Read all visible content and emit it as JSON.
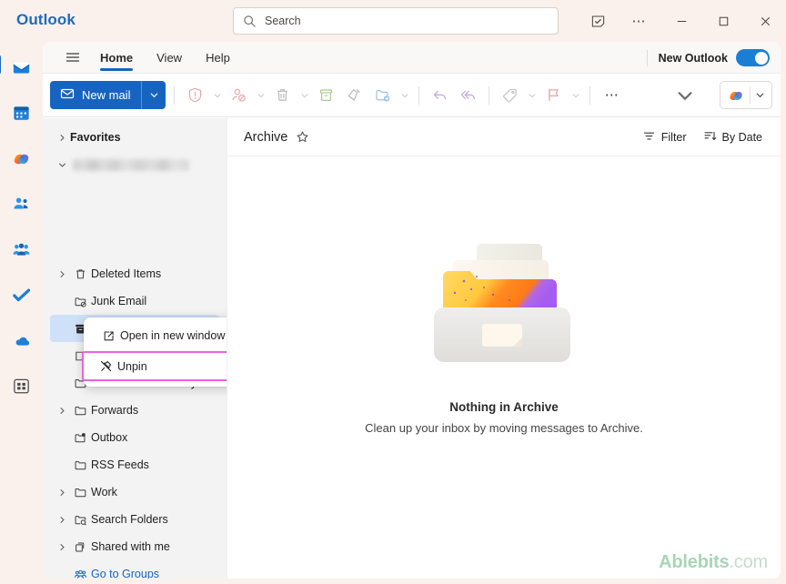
{
  "titlebar": {
    "brand": "Outlook",
    "search_placeholder": "Search",
    "buttons": [
      {
        "name": "notes-icon",
        "label": "Notes"
      },
      {
        "name": "more-options-icon",
        "label": "…"
      },
      {
        "name": "minimize-icon",
        "label": "Minimize"
      },
      {
        "name": "maximize-icon",
        "label": "Maximize"
      },
      {
        "name": "close-icon",
        "label": "Close"
      }
    ]
  },
  "rail": {
    "items": [
      {
        "icon": "mail-icon",
        "label": "Mail",
        "active": true
      },
      {
        "icon": "calendar-icon",
        "label": "Calendar",
        "active": false
      },
      {
        "icon": "copilot-icon",
        "label": "Copilot",
        "active": false
      },
      {
        "icon": "people-icon",
        "label": "People",
        "active": false
      },
      {
        "icon": "groups-icon",
        "label": "Groups",
        "active": false
      },
      {
        "icon": "todo-icon",
        "label": "To Do",
        "active": false
      },
      {
        "icon": "onedrive-icon",
        "label": "OneDrive",
        "active": false
      },
      {
        "icon": "apps-icon",
        "label": "More apps",
        "active": false
      }
    ]
  },
  "ribbon": {
    "tabs": [
      {
        "label": "Home",
        "active": true
      },
      {
        "label": "View",
        "active": false
      },
      {
        "label": "Help",
        "active": false
      }
    ],
    "new_outlook_label": "New Outlook",
    "new_outlook_on": true
  },
  "commandbar": {
    "new_mail_label": "New mail",
    "icons": [
      {
        "name": "report-icon",
        "caret": true
      },
      {
        "name": "block-sender-icon",
        "caret": true
      },
      {
        "name": "delete-icon",
        "caret": true
      },
      {
        "name": "archive-icon",
        "caret": false
      },
      {
        "name": "sweep-icon",
        "caret": false
      },
      {
        "name": "move-to-icon",
        "caret": true
      },
      {
        "name": "reply-icon",
        "caret": false
      },
      {
        "name": "reply-all-icon",
        "caret": false
      },
      {
        "name": "categorize-icon",
        "caret": true
      },
      {
        "name": "flag-icon",
        "caret": true
      }
    ],
    "more_commands_label": "…",
    "copilot_label": "Copilot"
  },
  "folders": {
    "items": [
      {
        "label": "Favorites",
        "chevron": "right",
        "icon": "",
        "bold": true,
        "selected": false,
        "blurred": false,
        "link": false
      },
      {
        "label": "",
        "chevron": "down",
        "icon": "",
        "bold": false,
        "selected": false,
        "blurred": true,
        "link": false
      },
      {
        "label": "Deleted Items",
        "chevron": "right",
        "icon": "trash-icon",
        "bold": false,
        "selected": false,
        "blurred": false,
        "link": false
      },
      {
        "label": "Junk Email",
        "chevron": "",
        "icon": "junk-icon",
        "bold": false,
        "selected": false,
        "blurred": false,
        "link": false
      },
      {
        "label": "Archive",
        "chevron": "",
        "icon": "archive-box-icon",
        "bold": false,
        "selected": true,
        "blurred": false,
        "link": false
      },
      {
        "label": "Notes",
        "chevron": "",
        "icon": "note-icon",
        "bold": false,
        "selected": false,
        "blurred": false,
        "link": false
      },
      {
        "label": "Conversation History",
        "chevron": "",
        "icon": "folder-icon",
        "bold": false,
        "selected": false,
        "blurred": false,
        "link": false
      },
      {
        "label": "Forwards",
        "chevron": "right",
        "icon": "folder-icon",
        "bold": false,
        "selected": false,
        "blurred": false,
        "link": false
      },
      {
        "label": "Outbox",
        "chevron": "",
        "icon": "outbox-icon",
        "bold": false,
        "selected": false,
        "blurred": false,
        "link": false
      },
      {
        "label": "RSS Feeds",
        "chevron": "",
        "icon": "folder-icon",
        "bold": false,
        "selected": false,
        "blurred": false,
        "link": false
      },
      {
        "label": "Work",
        "chevron": "right",
        "icon": "folder-icon",
        "bold": false,
        "selected": false,
        "blurred": false,
        "link": false
      },
      {
        "label": "Search Folders",
        "chevron": "right",
        "icon": "search-folder-icon",
        "bold": false,
        "selected": false,
        "blurred": false,
        "link": false
      },
      {
        "label": "Shared with me",
        "chevron": "right",
        "icon": "shared-folder-icon",
        "bold": false,
        "selected": false,
        "blurred": false,
        "link": false
      },
      {
        "label": "Go to Groups",
        "chevron": "",
        "icon": "groups-small-icon",
        "bold": false,
        "selected": false,
        "blurred": false,
        "link": true
      }
    ]
  },
  "context_menu": {
    "items": [
      {
        "label": "Open in new window",
        "icon": "open-new-window-icon",
        "highlighted": false
      },
      {
        "label": "Unpin",
        "icon": "unpin-icon",
        "highlighted": true
      }
    ],
    "highlight_color": "#ee5fe8"
  },
  "content": {
    "title": "Archive",
    "filter_label": "Filter",
    "sort_label": "By Date",
    "empty_title": "Nothing in Archive",
    "empty_subtitle": "Clean up your inbox by moving messages to Archive."
  },
  "watermark": {
    "bold": "Ablebits",
    "rest": ".com"
  }
}
